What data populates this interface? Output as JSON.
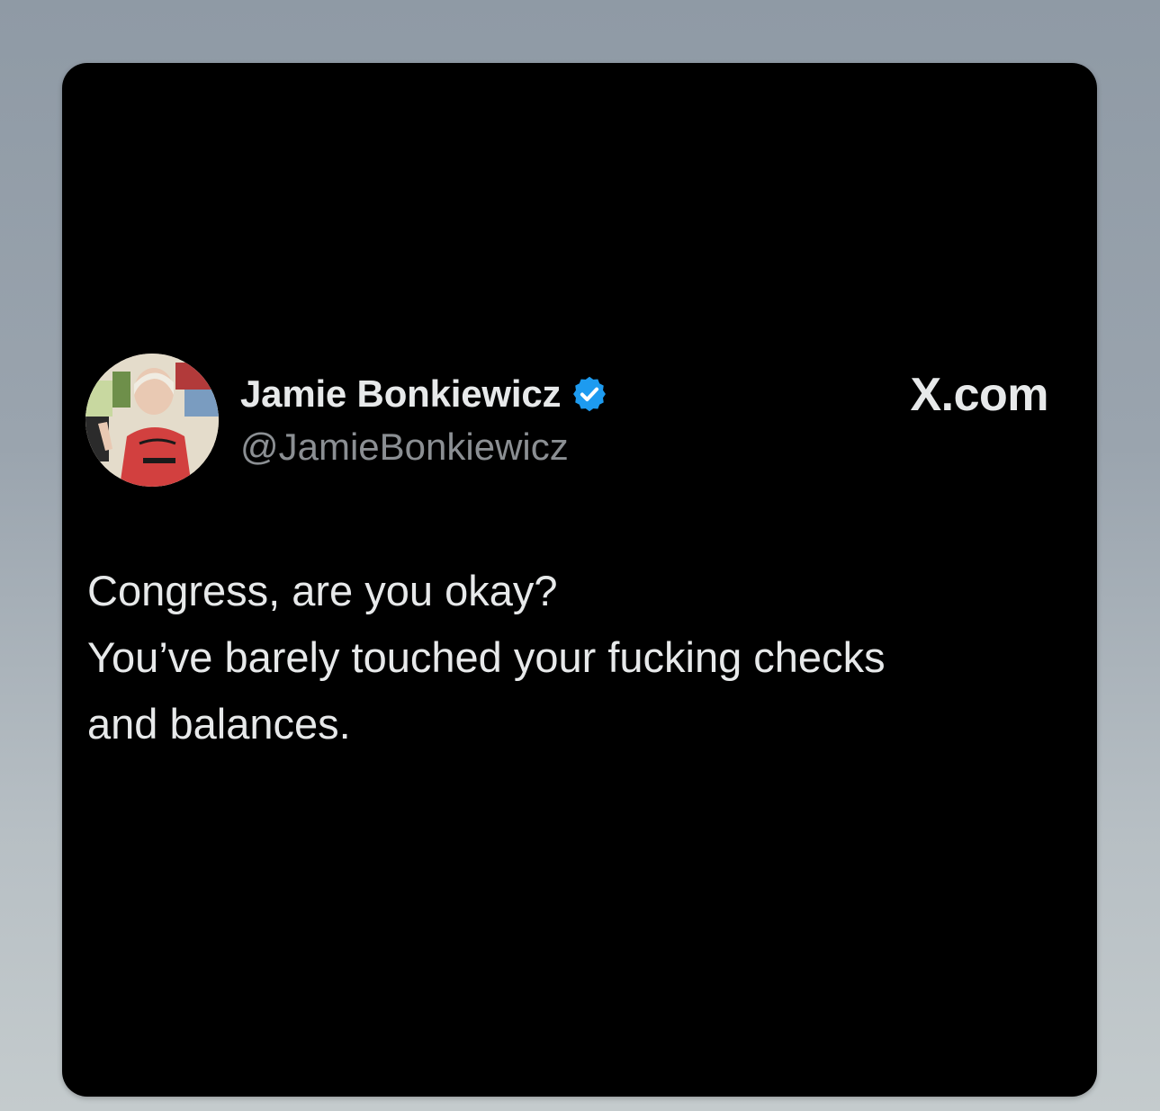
{
  "author": {
    "display_name": "Jamie Bonkiewicz",
    "handle": "@JamieBonkiewicz",
    "verified_icon": "verified-badge-icon",
    "avatar_icon": "profile-avatar"
  },
  "brand": {
    "label": "X.com"
  },
  "tweet": {
    "lines": [
      "Congress, are you okay?",
      "You’ve barely touched your fucking checks",
      "and balances."
    ]
  },
  "colors": {
    "card_background": "#000000",
    "primary_text": "#e7e9ea",
    "secondary_text": "#8b8f93",
    "verified_blue": "#1d9bf0"
  }
}
